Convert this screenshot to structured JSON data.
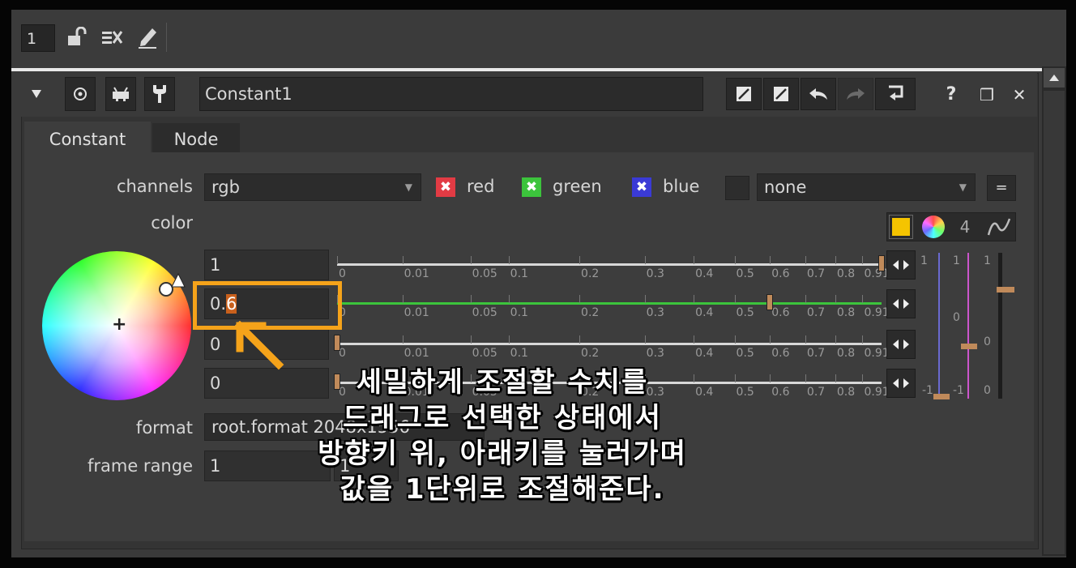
{
  "toolbar": {
    "number": "1",
    "icons": [
      "lock-icon",
      "input-icon",
      "pencil-icon"
    ]
  },
  "header": {
    "node_name": "Constant1",
    "left_icons": [
      "collapse-icon",
      "center-icon",
      "viewer-icon",
      "wrench-icon"
    ],
    "right_icons": [
      "slash-box-icon",
      "slash-box-icon",
      "undo-icon",
      "redo-icon",
      "revert-icon"
    ],
    "help": "?",
    "float": "❒",
    "close": "✕"
  },
  "tabs": [
    {
      "label": "Constant",
      "active": true
    },
    {
      "label": "Node",
      "active": false
    }
  ],
  "knobs": {
    "channels_label": "channels",
    "channels_value": "rgb",
    "red_label": "red",
    "green_label": "green",
    "blue_label": "blue",
    "none_value": "none",
    "eq_label": "=",
    "color_label": "color",
    "color_swatch": "#f5c400",
    "four_label": "4",
    "format_label": "format",
    "format_value": "root.format 2048x1556",
    "frame_range_label": "frame range",
    "frame_range_value": "1",
    "frame_range_end": "1"
  },
  "color_fields": [
    {
      "value": "1",
      "slider_fraction": 1.0
    },
    {
      "value": "0.6",
      "slider_fraction": 0.6,
      "selected": true
    },
    {
      "value": "0",
      "slider_fraction": 0.0
    },
    {
      "value": "0",
      "slider_fraction": 0.0
    }
  ],
  "slider_ticks": [
    "0",
    "0.01",
    "0.05",
    "0.1",
    "0.2",
    "0.3",
    "0.4",
    "0.5",
    "0.6",
    "0.7",
    "0.8",
    "0.91"
  ],
  "mini_scale": {
    "top": "1",
    "mid": "0",
    "bottom": "-1"
  },
  "subtitle": [
    "세밀하게 조절할 수치를",
    "드래그로 선택한 상태에서",
    "방향키 위, 아래키를 눌러가며",
    "값을 1단위로 조절해준다."
  ],
  "colors": {
    "highlight": "#f5a31a",
    "red": "#e23b44",
    "green": "#3cc43c",
    "blue": "#3a3ad6"
  }
}
